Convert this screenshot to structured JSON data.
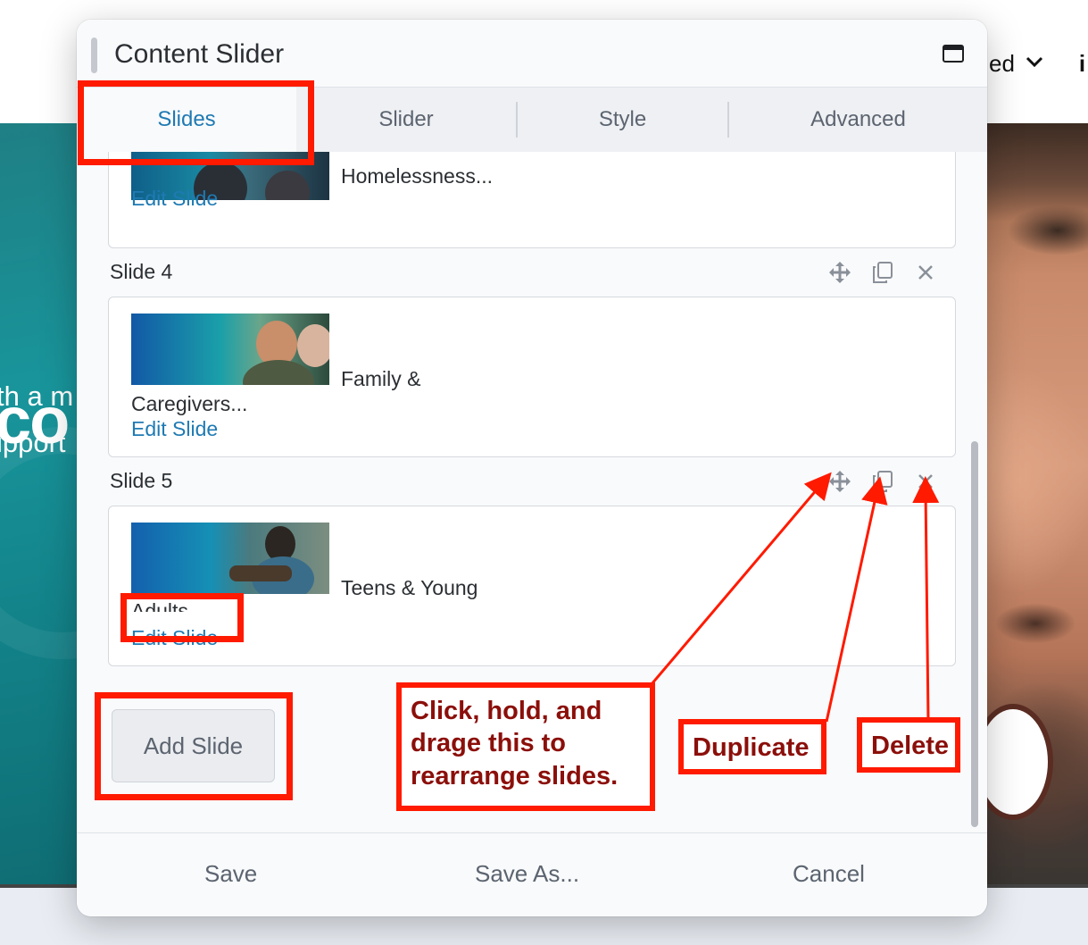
{
  "background": {
    "heading_fragment": "co",
    "line1_fragment": "th a m",
    "line2_fragment": "ipport",
    "nav_fragment": "ed",
    "nav_trailing": "i"
  },
  "modal": {
    "title": "Content Slider",
    "tabs": [
      {
        "label": "Slides",
        "active": true
      },
      {
        "label": "Slider",
        "active": false
      },
      {
        "label": "Style",
        "active": false
      },
      {
        "label": "Advanced",
        "active": false
      }
    ],
    "slides": [
      {
        "title": "",
        "text_line1": "Homelessness...",
        "text_line2": "",
        "edit_label": "Edit Slide"
      },
      {
        "title": "Slide 4",
        "text_line1": "Family &",
        "text_line2": "Caregivers...",
        "edit_label": "Edit Slide"
      },
      {
        "title": "Slide 5",
        "text_line1": "Teens & Young",
        "text_line2": "Adults",
        "edit_label": "Edit Slide"
      }
    ],
    "add_slide_label": "Add Slide",
    "footer": {
      "save": "Save",
      "save_as": "Save As...",
      "cancel": "Cancel"
    }
  },
  "annotations": {
    "move_note": "Click, hold, and drage this to rearrange slides.",
    "duplicate_note": "Duplicate",
    "delete_note": "Delete"
  },
  "colors": {
    "accent": "#1f7ab3",
    "annotation_red": "#ff1a00",
    "annotation_text": "#8b0f0a"
  },
  "icons": [
    "drag-handle-icon",
    "maximize-icon",
    "move-icon",
    "duplicate-icon",
    "delete-icon",
    "chevron-down-icon"
  ]
}
